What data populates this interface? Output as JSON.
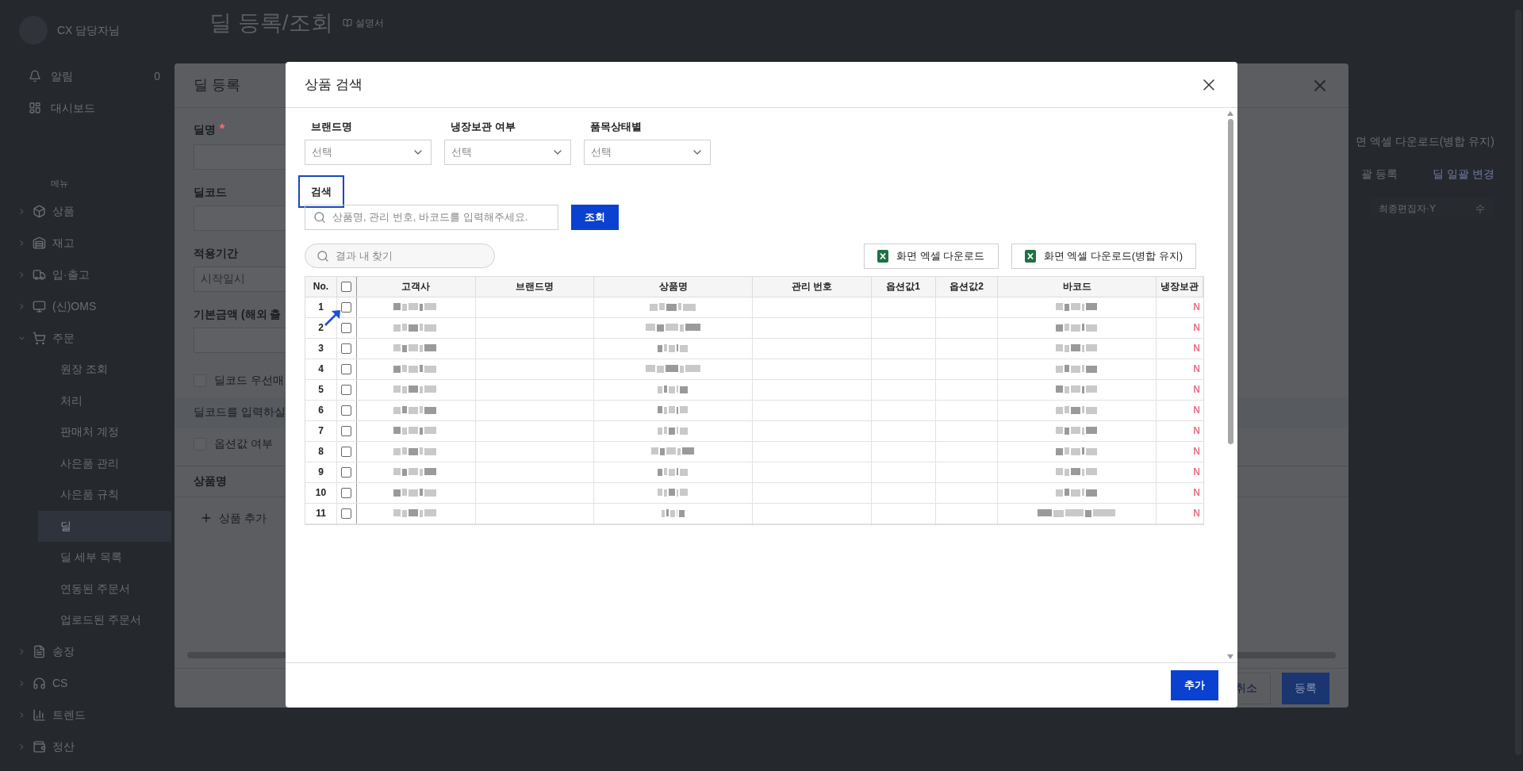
{
  "page": {
    "title": "딜 등록/조회",
    "manual_link": "설명서"
  },
  "sidebar": {
    "user": "CX 담당자님",
    "top_items": [
      {
        "label": "알림",
        "count": "0"
      },
      {
        "label": "대시보드"
      }
    ],
    "menu_heading": "메뉴",
    "menu": [
      {
        "label": "상품",
        "expanded": false
      },
      {
        "label": "재고",
        "expanded": false
      },
      {
        "label": "입·출고",
        "expanded": false
      },
      {
        "label": "(신)OMS",
        "expanded": false
      },
      {
        "label": "주문",
        "expanded": true,
        "children": [
          {
            "label": "원장 조회",
            "selected": false
          },
          {
            "label": "처리",
            "selected": false
          },
          {
            "label": "판매처 계정",
            "selected": false
          },
          {
            "label": "사은품 관리",
            "selected": false
          },
          {
            "label": "사은품 규칙",
            "selected": false
          },
          {
            "label": "딜",
            "selected": true
          },
          {
            "label": "딜 세부 목록",
            "selected": false
          },
          {
            "label": "연동된 주문서",
            "selected": false
          },
          {
            "label": "업로드된 주문서",
            "selected": false
          }
        ]
      },
      {
        "label": "송장",
        "expanded": false
      },
      {
        "label": "CS",
        "expanded": false
      },
      {
        "label": "트렌드",
        "expanded": false
      },
      {
        "label": "정산",
        "expanded": false
      }
    ]
  },
  "background": {
    "download_button": "면 엑셀 다운로드(병합 유지)",
    "bulk_register": "괄 등록",
    "bulk_change": "딜 일괄 변경",
    "column_header": "최종편집자·Y",
    "column_header_2": "수"
  },
  "deal_modal": {
    "title": "딜 등록",
    "fields": [
      {
        "kind": "input",
        "label": "딜명",
        "mark": "*"
      },
      {
        "kind": "input",
        "label": "딜코드"
      },
      {
        "kind": "input",
        "label": "적용기간",
        "placeholder": "시작일시"
      },
      {
        "kind": "input",
        "label": "기본금액 (해외 출"
      },
      {
        "kind": "checkbox",
        "label": "딜코드 우선매",
        "checked": false
      },
      {
        "kind": "note",
        "label": "딜코드를 입력하실"
      },
      {
        "kind": "checkbox",
        "label": "옵션값 여부",
        "checked": false
      }
    ],
    "section": "상품명",
    "add_product": "상품 추가",
    "buttons": [
      {
        "label": "취소",
        "primary": false
      },
      {
        "label": "등록",
        "primary": true
      }
    ]
  },
  "search_modal": {
    "title": "상품 검색",
    "filters": [
      {
        "label": "브랜드명",
        "placeholder": "선택"
      },
      {
        "label": "냉장보관 여부",
        "placeholder": "선택"
      },
      {
        "label": "품목상태별",
        "placeholder": "선택"
      }
    ],
    "search": {
      "label": "검색",
      "highlighted": true,
      "placeholder": "상품명, 관리 번호, 바코드를 입력해주세요.",
      "button": "조회"
    },
    "result_search": {
      "placeholder": "결과 내 찾기"
    },
    "downloads": [
      "화면 엑셀 다운로드",
      "화면 엑셀 다운로드(병합 유지)"
    ],
    "table": {
      "columns": [
        "No.",
        "고객사",
        "브랜드명",
        "상품명",
        "관리 번호",
        "옵션값1",
        "옵션값2",
        "바코드",
        "냉장보관"
      ],
      "all_checked": false,
      "rows": [
        {
          "no": "1",
          "checked": false,
          "cold": "N"
        },
        {
          "no": "2",
          "checked": false,
          "cold": "N"
        },
        {
          "no": "3",
          "checked": false,
          "cold": "N"
        },
        {
          "no": "4",
          "checked": false,
          "cold": "N"
        },
        {
          "no": "5",
          "checked": false,
          "cold": "N"
        },
        {
          "no": "6",
          "checked": false,
          "cold": "N"
        },
        {
          "no": "7",
          "checked": false,
          "cold": "N"
        },
        {
          "no": "8",
          "checked": false,
          "cold": "N"
        },
        {
          "no": "9",
          "checked": false,
          "cold": "N"
        },
        {
          "no": "10",
          "checked": false,
          "cold": "N"
        },
        {
          "no": "11",
          "checked": false,
          "cold": "N"
        }
      ]
    },
    "add_button": "추가"
  }
}
